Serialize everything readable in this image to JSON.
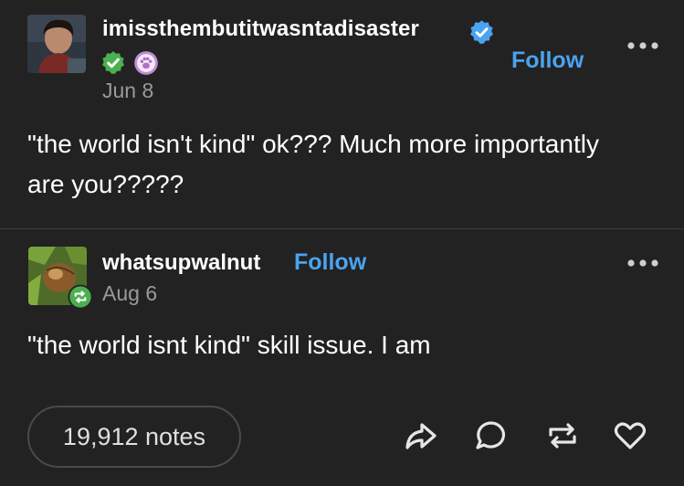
{
  "post": {
    "author": "imissthembutitwasntadisaster",
    "follow_label": "Follow",
    "date": "Jun 8",
    "text": "\"the world isn't kind\" ok??? Much more importantly are you?????"
  },
  "reblog": {
    "author": "whatsupwalnut",
    "follow_label": "Follow",
    "date": "Aug 6",
    "text": "\"the world isnt kind\" skill issue. I am"
  },
  "footer": {
    "notes_label": "19,912 notes"
  },
  "icons": {
    "verified": "verified-badge-icon",
    "check_badge": "check-badge-icon",
    "paw_badge": "paw-badge-icon",
    "reblog_badge": "reblog-badge-icon",
    "more": "more-options-icon",
    "share": "share-icon",
    "reply": "reply-icon",
    "reblog": "reblog-icon",
    "like": "heart-icon"
  },
  "colors": {
    "background": "#222222",
    "accent": "#4aa3f0",
    "muted": "#9a9a9a",
    "green_badge": "#4caf50"
  }
}
